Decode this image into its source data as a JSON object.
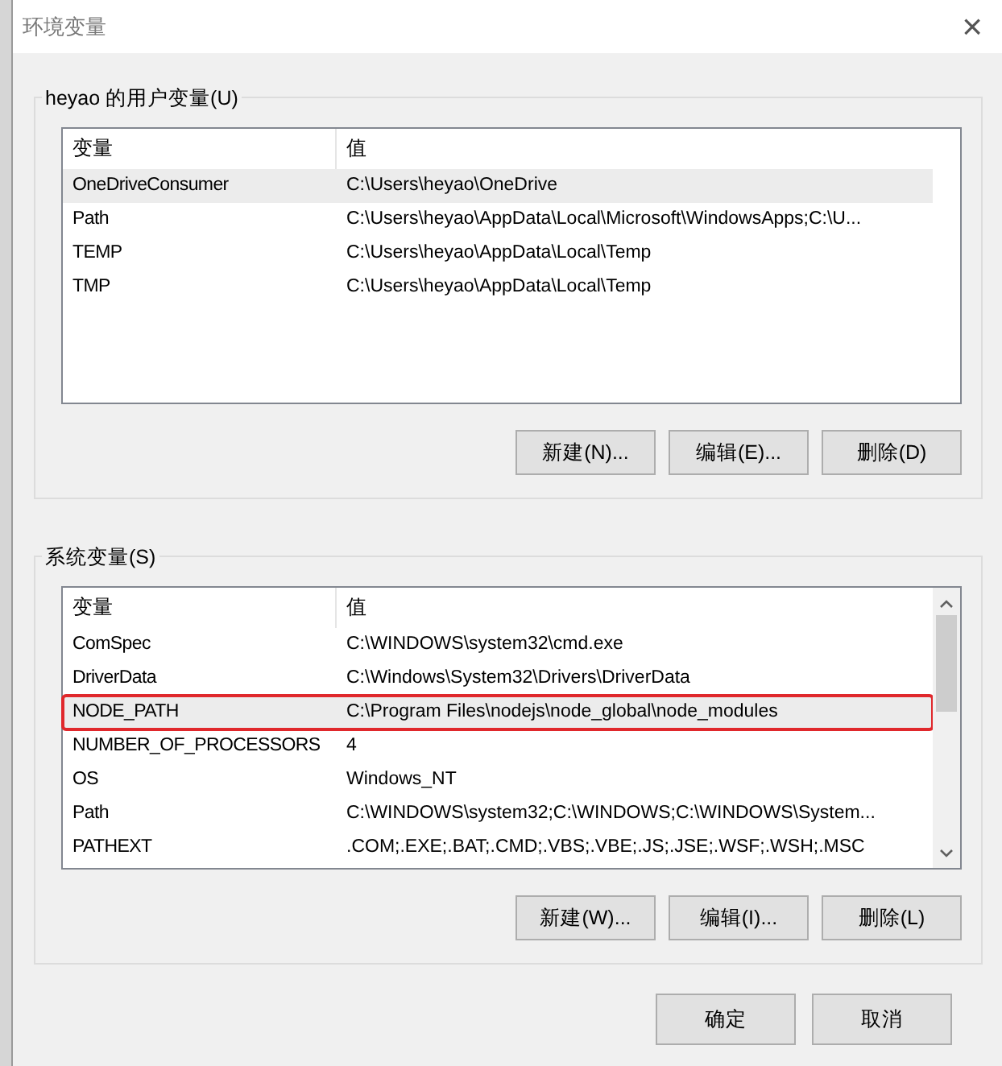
{
  "window": {
    "title": "环境变量",
    "close": "×"
  },
  "user_group": {
    "title": "heyao 的用户变量(U)",
    "columns": [
      "变量",
      "值"
    ],
    "rows": [
      {
        "name": "OneDriveConsumer",
        "value": "C:\\Users\\heyao\\OneDrive",
        "selected": true,
        "annotated": false
      },
      {
        "name": "Path",
        "value": "C:\\Users\\heyao\\AppData\\Local\\Microsoft\\WindowsApps;C:\\U...",
        "selected": false,
        "annotated": false
      },
      {
        "name": "TEMP",
        "value": "C:\\Users\\heyao\\AppData\\Local\\Temp",
        "selected": false,
        "annotated": false
      },
      {
        "name": "TMP",
        "value": "C:\\Users\\heyao\\AppData\\Local\\Temp",
        "selected": false,
        "annotated": false
      }
    ],
    "buttons": [
      "新建(N)...",
      "编辑(E)...",
      "删除(D)"
    ]
  },
  "system_group": {
    "title": "系统变量(S)",
    "columns": [
      "变量",
      "值"
    ],
    "rows": [
      {
        "name": "ComSpec",
        "value": "C:\\WINDOWS\\system32\\cmd.exe",
        "selected": false,
        "annotated": false
      },
      {
        "name": "DriverData",
        "value": "C:\\Windows\\System32\\Drivers\\DriverData",
        "selected": false,
        "annotated": false
      },
      {
        "name": "NODE_PATH",
        "value": "C:\\Program Files\\nodejs\\node_global\\node_modules",
        "selected": true,
        "annotated": true
      },
      {
        "name": "NUMBER_OF_PROCESSORS",
        "value": "4",
        "selected": false,
        "annotated": false
      },
      {
        "name": "OS",
        "value": "Windows_NT",
        "selected": false,
        "annotated": false
      },
      {
        "name": "Path",
        "value": "C:\\WINDOWS\\system32;C:\\WINDOWS;C:\\WINDOWS\\System...",
        "selected": false,
        "annotated": false
      },
      {
        "name": "PATHEXT",
        "value": ".COM;.EXE;.BAT;.CMD;.VBS;.VBE;.JS;.JSE;.WSF;.WSH;.MSC",
        "selected": false,
        "annotated": false
      }
    ],
    "buttons": [
      "新建(W)...",
      "编辑(I)...",
      "删除(L)"
    ]
  },
  "dialog_buttons": [
    "确定",
    "取消"
  ]
}
